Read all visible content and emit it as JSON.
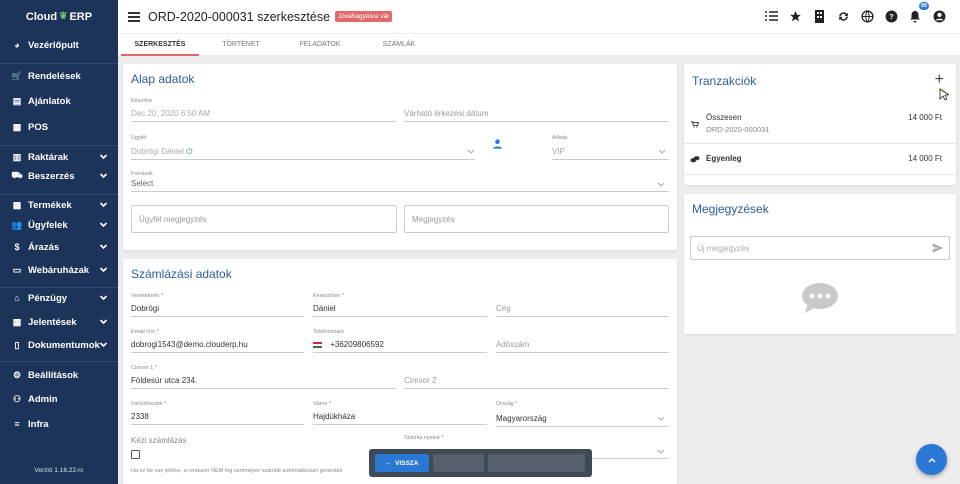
{
  "brand": {
    "name_left": "Cloud",
    "name_right": "ERP"
  },
  "sidebar": {
    "items": [
      {
        "label": "Vezérlőpult",
        "icon": "dashboard-icon",
        "chevron": false
      },
      {
        "label": "Rendelések",
        "icon": "cart-icon",
        "chevron": false
      },
      {
        "label": "Ajánlatok",
        "icon": "document-icon",
        "chevron": false
      },
      {
        "label": "POS",
        "icon": "pos-icon",
        "chevron": false
      },
      {
        "label": "Raktárak",
        "icon": "warehouse-icon",
        "chevron": true
      },
      {
        "label": "Beszerzés",
        "icon": "truck-icon",
        "chevron": true
      },
      {
        "label": "Termékek",
        "icon": "boxes-icon",
        "chevron": true
      },
      {
        "label": "Ügyfelek",
        "icon": "users-icon",
        "chevron": true
      },
      {
        "label": "Árazás",
        "icon": "dollar-icon",
        "chevron": true
      },
      {
        "label": "Webáruházak",
        "icon": "webshop-icon",
        "chevron": true
      },
      {
        "label": "Pénzügy",
        "icon": "bank-icon",
        "chevron": true
      },
      {
        "label": "Jelentések",
        "icon": "table-icon",
        "chevron": true
      },
      {
        "label": "Dokumentumok",
        "icon": "file-icon",
        "chevron": true
      },
      {
        "label": "Beállítások",
        "icon": "gear-icon",
        "chevron": false
      },
      {
        "label": "Admin",
        "icon": "admin-icon",
        "chevron": false
      },
      {
        "label": "Infra",
        "icon": "list-icon",
        "chevron": false
      }
    ],
    "version": "Verzió 1.16.22-rc"
  },
  "header": {
    "title": "ORD-2020-000031 szerkesztése",
    "status_badge": "Jóváhagyásra vár",
    "notification_count": "99"
  },
  "tabs": [
    {
      "label": "SZERKESZTÉS",
      "active": true
    },
    {
      "label": "TÖRTÉNET",
      "active": false
    },
    {
      "label": "FELADATOK",
      "active": false
    },
    {
      "label": "SZÁMLÁK",
      "active": false
    }
  ],
  "alap": {
    "title": "Alap adatok",
    "created_label": "Készítve",
    "created_value": "Dec 20, 2020 6:50 AM",
    "arrival_placeholder": "Várható érkezési dátum",
    "customer_label": "Ügyfél",
    "customer_value": "Dobrógi Dániel",
    "category_label": "Árlista",
    "category_value": "VIP",
    "source_label": "Források",
    "source_value": "Select",
    "customer_note_placeholder": "Ügyfél megjegyzés",
    "note_placeholder": "Megjegyzés"
  },
  "szamlazasi": {
    "title": "Számlázási adatok",
    "lastname_label": "Vezetéknév *",
    "lastname_value": "Dobrógi",
    "firstname_label": "Keresztnév *",
    "firstname_value": "Dániel",
    "company_placeholder": "Cég",
    "email_label": "Email cím *",
    "email_value": "dobrogi1543@demo.clouderp.hu",
    "phone_label": "Telefonszám",
    "phone_value": "+36209806592",
    "tax_placeholder": "Adószám",
    "address1_label": "Címsor 1 *",
    "address1_value": "Földesúr utca 234.",
    "address2_placeholder": "Címsor 2",
    "zip_label": "Irányítószám *",
    "zip_value": "2338",
    "city_label": "Város *",
    "city_value": "Hajdúkháza",
    "country_label": "Ország *",
    "country_value": "Magyarország",
    "manual_label": "Kézi számlázás",
    "language_label": "Számla nyelve *",
    "hint": "Ha ez be van jelölve, a rendszer NEM fog semmilyen számlát automatikusan generálni"
  },
  "tranzakciok": {
    "title": "Tranzakciók",
    "rows": [
      {
        "label": "Összesen",
        "sub": "ORD-2020-000031",
        "amount": "14 000 Ft",
        "icon": "cart-icon",
        "bold": false
      },
      {
        "label": "Egyenleg",
        "sub": "",
        "amount": "14 000 Ft",
        "icon": "coins-icon",
        "bold": true
      }
    ]
  },
  "megjegyzesek": {
    "title": "Megjegyzések",
    "new_placeholder": "Új megjegyzés"
  },
  "actions": {
    "back_label": "VISSZA"
  },
  "colors": {
    "sidebar": "#1c3459",
    "accent": "#2d5d9a",
    "primary": "#2979d4",
    "badge": "#e06a6a"
  }
}
